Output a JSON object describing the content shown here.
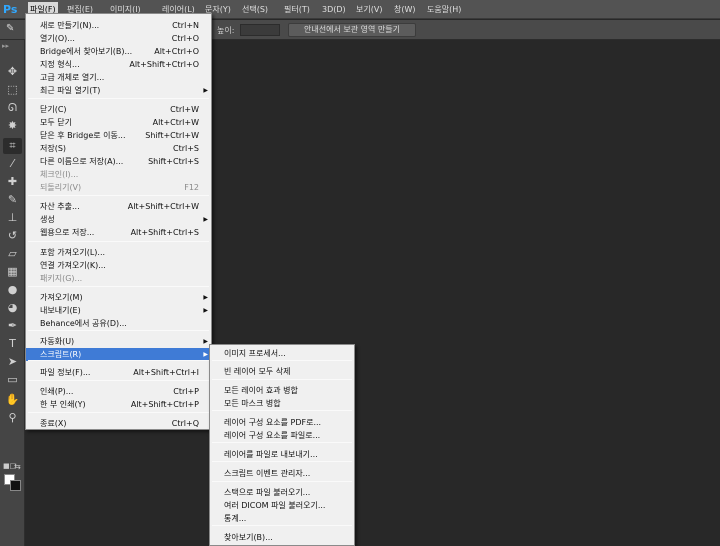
{
  "app": {
    "logo": "Ps"
  },
  "menubar": {
    "items": [
      "파일(F)",
      "편집(E)",
      "이미지(I)",
      "레이어(L)",
      "문자(Y)",
      "선택(S)",
      "필터(T)",
      "3D(D)",
      "보기(V)",
      "창(W)",
      "도움말(H)"
    ]
  },
  "options": {
    "height_label": "높이:",
    "height_value": "",
    "refine_button": "안내선에서 보관 영역 만들기"
  },
  "file_menu": [
    {
      "label": "새로 만들기(N)...",
      "shortcut": "Ctrl+N"
    },
    {
      "label": "열기(O)...",
      "shortcut": "Ctrl+O"
    },
    {
      "label": "Bridge에서 찾아보기(B)...",
      "shortcut": "Alt+Ctrl+O"
    },
    {
      "label": "지정 형식...",
      "shortcut": "Alt+Shift+Ctrl+O"
    },
    {
      "label": "고급 개체로 열기...",
      "shortcut": ""
    },
    {
      "label": "최근 파일 열기(T)",
      "shortcut": "",
      "submenu": true
    },
    {
      "label": "닫기(C)",
      "shortcut": "Ctrl+W"
    },
    {
      "label": "모두 닫기",
      "shortcut": "Alt+Ctrl+W"
    },
    {
      "label": "닫은 후 Bridge로 이동...",
      "shortcut": "Shift+Ctrl+W"
    },
    {
      "label": "저장(S)",
      "shortcut": "Ctrl+S"
    },
    {
      "label": "다른 이름으로 저장(A)...",
      "shortcut": "Shift+Ctrl+S"
    },
    {
      "label": "체크인(I)...",
      "shortcut": "",
      "disabled": true
    },
    {
      "label": "되돌리기(V)",
      "shortcut": "F12",
      "disabled": true
    },
    {
      "label": "자산 추출...",
      "shortcut": "Alt+Shift+Ctrl+W"
    },
    {
      "label": "생성",
      "shortcut": "",
      "submenu": true
    },
    {
      "label": "웹용으로 저장...",
      "shortcut": "Alt+Shift+Ctrl+S"
    },
    {
      "label": "포함 가져오기(L)...",
      "shortcut": ""
    },
    {
      "label": "연결 가져오기(K)...",
      "shortcut": ""
    },
    {
      "label": "패키지(G)...",
      "shortcut": "",
      "disabled": true
    },
    {
      "label": "가져오기(M)",
      "shortcut": "",
      "submenu": true
    },
    {
      "label": "내보내기(E)",
      "shortcut": "",
      "submenu": true
    },
    {
      "label": "Behance에서 공유(D)...",
      "shortcut": ""
    },
    {
      "label": "자동화(U)",
      "shortcut": "",
      "submenu": true
    },
    {
      "label": "스크립트(R)",
      "shortcut": "",
      "submenu": true,
      "highlight": true
    },
    {
      "label": "파일 정보(F)...",
      "shortcut": "Alt+Shift+Ctrl+I"
    },
    {
      "label": "인쇄(P)...",
      "shortcut": "Ctrl+P"
    },
    {
      "label": "한 부 인쇄(Y)",
      "shortcut": "Alt+Shift+Ctrl+P"
    },
    {
      "label": "종료(X)",
      "shortcut": "Ctrl+Q"
    }
  ],
  "script_menu": [
    {
      "label": "이미지 프로세서..."
    },
    {
      "label": "빈 레이어 모두 삭제"
    },
    {
      "label": "모든 레이어 효과 병합"
    },
    {
      "label": "모든 마스크 병합"
    },
    {
      "label": "레이어 구성 요소를 PDF로..."
    },
    {
      "label": "레이어 구성 요소를 파일로..."
    },
    {
      "label": "레이어를 파일로 내보내기..."
    },
    {
      "label": "스크립트 이벤트 관리자..."
    },
    {
      "label": "스택으로 파일 불러오기..."
    },
    {
      "label": "여러 DICOM 파일 불러오기..."
    },
    {
      "label": "통계..."
    },
    {
      "label": "찾아보기(B)..."
    }
  ],
  "tools": [
    {
      "icon": "move-icon",
      "glyph": "✥"
    },
    {
      "icon": "marquee-icon",
      "glyph": "⬚"
    },
    {
      "icon": "lasso-icon",
      "glyph": "ᘏ"
    },
    {
      "icon": "magic-wand-icon",
      "glyph": "✸"
    },
    {
      "icon": "crop-icon",
      "glyph": "⌗"
    },
    {
      "icon": "eyedropper-icon",
      "glyph": "⁄"
    },
    {
      "icon": "healing-brush-icon",
      "glyph": "✚"
    },
    {
      "icon": "brush-icon",
      "glyph": "✎"
    },
    {
      "icon": "clone-stamp-icon",
      "glyph": "⊥"
    },
    {
      "icon": "history-brush-icon",
      "glyph": "↺"
    },
    {
      "icon": "eraser-icon",
      "glyph": "▱"
    },
    {
      "icon": "gradient-icon",
      "glyph": "▦"
    },
    {
      "icon": "blur-icon",
      "glyph": "●"
    },
    {
      "icon": "dodge-icon",
      "glyph": "◕"
    },
    {
      "icon": "pen-icon",
      "glyph": "✒"
    },
    {
      "icon": "type-icon",
      "glyph": "T"
    },
    {
      "icon": "path-selection-icon",
      "glyph": "➤"
    },
    {
      "icon": "rectangle-shape-icon",
      "glyph": "▭"
    },
    {
      "icon": "hand-icon",
      "glyph": "✋"
    },
    {
      "icon": "zoom-icon",
      "glyph": "⚲"
    }
  ],
  "colors": {
    "foreground": "#ffffff",
    "background": "#111111",
    "highlight": "#3f7bd6",
    "canvas": "#282828"
  }
}
